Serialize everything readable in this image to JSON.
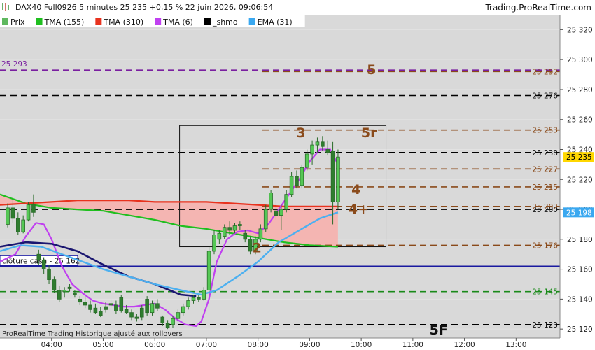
{
  "header": {
    "title": "DAX40 Full0926 5 minutes 25 235 +0,15 % 22 juin 2026, 09:06:54",
    "brand": "Trading.ProRealTime.com"
  },
  "legend": [
    {
      "label": "Prix",
      "color": "#5fb85f"
    },
    {
      "label": "TMA (155)",
      "color": "#1fbf1f"
    },
    {
      "label": "TMA (310)",
      "color": "#e8321e"
    },
    {
      "label": "TMA (6)",
      "color": "#c040f0"
    },
    {
      "label": "_shmo",
      "color": "#000000"
    },
    {
      "label": "EMA (31)",
      "color": "#3aa8f0"
    }
  ],
  "footer": {
    "note": "ProRealTime Trading  Historique ajusté aux rollovers"
  },
  "chart_data": {
    "type": "candlestick",
    "ylim": [
      25114,
      25330
    ],
    "y_ticks": [
      25120,
      25140,
      25160,
      25180,
      25200,
      25220,
      25240,
      25260,
      25280,
      25300,
      25320
    ],
    "y_tick_labels": [
      "25 120",
      "25 140",
      "25 160",
      "25 180",
      "25 200",
      "25 220",
      "25 240",
      "25 260",
      "25 280",
      "25 300",
      "25 320"
    ],
    "x_ticks": [
      "04:00",
      "05:00",
      "06:00",
      "07:00",
      "08:00",
      "09:00",
      "10:00",
      "11:00",
      "12:00",
      "13:00"
    ],
    "price_tags": [
      {
        "text": "25 235",
        "value": 25235,
        "bg": "#ffd700",
        "fg": "#000000"
      },
      {
        "text": "25 198",
        "value": 25198,
        "bg": "#3aa8f0",
        "fg": "#ffffff"
      }
    ],
    "levels": [
      {
        "value": 25293,
        "color": "#7a1fa0",
        "style": "dashed",
        "from": "start",
        "text": "25 293",
        "text_pos": "left"
      },
      {
        "value": 25292,
        "color": "#8a4a1a",
        "style": "dashed",
        "from": "mid",
        "text": "25 292",
        "text_pos": "right"
      },
      {
        "value": 25276,
        "color": "#000000",
        "style": "dashed",
        "from": "start",
        "text": "25 276",
        "text_pos": "right"
      },
      {
        "value": 25253,
        "color": "#8a4a1a",
        "style": "dashed",
        "from": "mid",
        "text": "25 253",
        "text_pos": "right"
      },
      {
        "value": 25238,
        "color": "#000000",
        "style": "dashed",
        "from": "start",
        "text": "25 238",
        "text_pos": "right"
      },
      {
        "value": 25227,
        "color": "#8a4a1a",
        "style": "dashed",
        "from": "mid",
        "text": "25 227",
        "text_pos": "right"
      },
      {
        "value": 25215,
        "color": "#8a4a1a",
        "style": "dashed",
        "from": "mid",
        "text": "25 215",
        "text_pos": "right"
      },
      {
        "value": 25202,
        "color": "#8a4a1a",
        "style": "dashed",
        "from": "mid",
        "text": "25 202",
        "text_pos": "right"
      },
      {
        "value": 25200,
        "color": "#000000",
        "style": "dashed",
        "from": "start",
        "text": "25 200",
        "text_pos": "right"
      },
      {
        "value": 25176,
        "color": "#8a4a1a",
        "style": "dashed",
        "from": "mid",
        "text": "25 176",
        "text_pos": "right"
      },
      {
        "value": 25162,
        "color": "#1a1aa0",
        "style": "solid",
        "from": "start",
        "text": "clôture cash -  25 162",
        "text_pos": "box"
      },
      {
        "value": 25145,
        "color": "#1a8a1a",
        "style": "dashed",
        "from": "start",
        "text": "25 145",
        "text_pos": "right"
      },
      {
        "value": 25123,
        "color": "#000000",
        "style": "dashed",
        "from": "start",
        "text": "25 123",
        "text_pos": "right"
      }
    ],
    "annotations": [
      {
        "text": "5",
        "time": 10.2,
        "value": 25294
      },
      {
        "text": "5r",
        "time": 10.15,
        "value": 25252
      },
      {
        "text": "4",
        "time": 9.9,
        "value": 25214
      },
      {
        "text": "4+",
        "time": 9.95,
        "value": 25201
      },
      {
        "text": "3",
        "time": 8.83,
        "value": 25252
      },
      {
        "text": "2",
        "time": 7.98,
        "value": 25175
      },
      {
        "text": "5F",
        "time": 11.5,
        "value": 25120
      }
    ],
    "box": {
      "t0": 6.48,
      "t1": 10.48,
      "v0": 25175,
      "v1": 25256
    },
    "candles": [
      [
        3.15,
        25190,
        25204,
        25188,
        25201
      ],
      [
        3.25,
        25201,
        25206,
        25191,
        25194
      ],
      [
        3.35,
        25194,
        25198,
        25183,
        25185
      ],
      [
        3.45,
        25185,
        25196,
        25184,
        25193
      ],
      [
        3.55,
        25193,
        25205,
        25192,
        25203
      ],
      [
        3.65,
        25203,
        25210,
        25195,
        25198
      ],
      [
        3.75,
        25170,
        25173,
        25163,
        25166
      ],
      [
        3.85,
        25166,
        25168,
        25157,
        25160
      ],
      [
        3.95,
        25160,
        25163,
        25150,
        25153
      ],
      [
        4.05,
        25153,
        25155,
        25144,
        25146
      ],
      [
        4.15,
        25146,
        25149,
        25138,
        25140
      ],
      [
        4.25,
        25145,
        25148,
        25141,
        25146
      ],
      [
        4.35,
        25148,
        25150,
        25145,
        25147
      ],
      [
        4.45,
        25144,
        25146,
        25141,
        25143
      ],
      [
        4.55,
        25140,
        25142,
        25136,
        25138
      ],
      [
        4.65,
        25138,
        25141,
        25134,
        25136
      ],
      [
        4.75,
        25136,
        25139,
        25131,
        25133
      ],
      [
        4.85,
        25134,
        25137,
        25130,
        25131
      ],
      [
        4.95,
        25132,
        25135,
        25128,
        25129
      ],
      [
        5.05,
        25135,
        25138,
        25131,
        25133
      ],
      [
        5.15,
        25137,
        25140,
        25134,
        25136
      ],
      [
        5.25,
        25136,
        25139,
        25130,
        25132
      ],
      [
        5.35,
        25141,
        25143,
        25131,
        25132
      ],
      [
        5.45,
        25133,
        25136,
        25130,
        25131
      ],
      [
        5.55,
        25131,
        25133,
        25126,
        25128
      ],
      [
        5.65,
        25128,
        25130,
        25125,
        25127
      ],
      [
        5.75,
        25134,
        25136,
        25126,
        25128
      ],
      [
        5.85,
        25140,
        25142,
        25129,
        25131
      ],
      [
        5.95,
        25131,
        25139,
        25129,
        25137
      ],
      [
        6.05,
        25137,
        25140,
        25132,
        25134
      ],
      [
        6.15,
        25128,
        25129,
        25122,
        25124
      ],
      [
        6.25,
        25124,
        25126,
        25120,
        25121
      ],
      [
        6.35,
        25123,
        25129,
        25121,
        25127
      ],
      [
        6.45,
        25127,
        25133,
        25125,
        25131
      ],
      [
        6.55,
        25131,
        25137,
        25129,
        25135
      ],
      [
        6.65,
        25135,
        25141,
        25133,
        25139
      ],
      [
        6.75,
        25139,
        25143,
        25137,
        25141
      ],
      [
        6.85,
        25141,
        25143,
        25138,
        25140
      ],
      [
        6.95,
        25140,
        25148,
        25139,
        25146
      ],
      [
        7.05,
        25146,
        25175,
        25144,
        25172
      ],
      [
        7.15,
        25172,
        25186,
        25170,
        25183
      ],
      [
        7.25,
        25180,
        25186,
        25177,
        25184
      ],
      [
        7.35,
        25182,
        25190,
        25180,
        25188
      ],
      [
        7.45,
        25188,
        25192,
        25183,
        25186
      ],
      [
        7.55,
        25186,
        25191,
        25184,
        25189
      ],
      [
        7.65,
        25189,
        25192,
        25186,
        25190
      ],
      [
        7.75,
        25184,
        25186,
        25178,
        25180
      ],
      [
        7.85,
        25180,
        25182,
        25170,
        25172
      ],
      [
        7.95,
        25172,
        25182,
        25170,
        25180
      ],
      [
        8.05,
        25180,
        25190,
        25178,
        25187
      ],
      [
        8.15,
        25187,
        25203,
        25185,
        25200
      ],
      [
        8.25,
        25200,
        25213,
        25198,
        25211
      ],
      [
        8.35,
        25199,
        25206,
        25193,
        25196
      ],
      [
        8.45,
        25196,
        25203,
        25186,
        25200
      ],
      [
        8.55,
        25200,
        25213,
        25198,
        25210
      ],
      [
        8.65,
        25210,
        25225,
        25208,
        25222
      ],
      [
        8.75,
        25222,
        25226,
        25214,
        25216
      ],
      [
        8.85,
        25216,
        25230,
        25214,
        25228
      ],
      [
        8.95,
        25228,
        25240,
        25226,
        25237
      ],
      [
        9.05,
        25237,
        25246,
        25230,
        25243
      ],
      [
        9.15,
        25243,
        25248,
        25238,
        25245
      ],
      [
        9.25,
        25245,
        25249,
        25239,
        25242
      ],
      [
        9.35,
        25240,
        25246,
        25236,
        25238
      ],
      [
        9.45,
        25239,
        25245,
        25190,
        25205
      ],
      [
        9.55,
        25205,
        25240,
        25200,
        25235
      ]
    ],
    "series": [
      {
        "name": "TMA (155)",
        "color": "#1fbf1f",
        "width": 2.2,
        "points": [
          [
            3.0,
            25210
          ],
          [
            3.5,
            25204
          ],
          [
            4.0,
            25201
          ],
          [
            4.5,
            25200
          ],
          [
            5.0,
            25199
          ],
          [
            5.5,
            25196
          ],
          [
            6.0,
            25193
          ],
          [
            6.5,
            25189
          ],
          [
            7.0,
            25187
          ],
          [
            7.5,
            25184
          ],
          [
            8.0,
            25181
          ],
          [
            8.5,
            25178
          ],
          [
            9.0,
            25176
          ],
          [
            9.55,
            25175
          ]
        ]
      },
      {
        "name": "TMA (310)",
        "color": "#e8321e",
        "width": 2.2,
        "points": [
          [
            3.0,
            25203
          ],
          [
            3.5,
            25204
          ],
          [
            4.0,
            25205
          ],
          [
            4.5,
            25206
          ],
          [
            5.0,
            25206
          ],
          [
            5.5,
            25206
          ],
          [
            6.0,
            25205
          ],
          [
            6.5,
            25205
          ],
          [
            7.0,
            25205
          ],
          [
            7.5,
            25204
          ],
          [
            8.0,
            25203
          ],
          [
            8.5,
            25202
          ],
          [
            9.0,
            25202
          ],
          [
            9.55,
            25202
          ]
        ]
      },
      {
        "name": "TMA (6)",
        "color": "#c040f0",
        "width": 2.2,
        "points": [
          [
            3.0,
            25165
          ],
          [
            3.3,
            25170
          ],
          [
            3.5,
            25182
          ],
          [
            3.7,
            25191
          ],
          [
            3.85,
            25190
          ],
          [
            4.0,
            25180
          ],
          [
            4.2,
            25162
          ],
          [
            4.4,
            25150
          ],
          [
            4.6,
            25144
          ],
          [
            4.8,
            25139
          ],
          [
            5.0,
            25137
          ],
          [
            5.2,
            25136
          ],
          [
            5.4,
            25135
          ],
          [
            5.6,
            25135
          ],
          [
            5.8,
            25136
          ],
          [
            6.0,
            25137
          ],
          [
            6.2,
            25133
          ],
          [
            6.4,
            25127
          ],
          [
            6.6,
            25123
          ],
          [
            6.8,
            25122
          ],
          [
            6.9,
            25125
          ],
          [
            7.05,
            25140
          ],
          [
            7.2,
            25165
          ],
          [
            7.4,
            25180
          ],
          [
            7.6,
            25185
          ],
          [
            7.8,
            25186
          ],
          [
            8.0,
            25184
          ],
          [
            8.2,
            25190
          ],
          [
            8.4,
            25200
          ],
          [
            8.6,
            25210
          ],
          [
            8.8,
            25220
          ],
          [
            9.0,
            25232
          ],
          [
            9.2,
            25240
          ],
          [
            9.4,
            25240
          ],
          [
            9.55,
            25230
          ]
        ]
      },
      {
        "name": "_shmo",
        "color": "#1a1670",
        "width": 2.6,
        "points": [
          [
            3.0,
            25175
          ],
          [
            3.5,
            25178
          ],
          [
            4.0,
            25177
          ],
          [
            4.5,
            25172
          ],
          [
            5.0,
            25163
          ],
          [
            5.5,
            25155
          ],
          [
            6.0,
            25150
          ],
          [
            6.5,
            25143
          ],
          [
            6.8,
            25142
          ]
        ]
      },
      {
        "name": "EMA (31)",
        "color": "#4cb0f0",
        "width": 2.4,
        "points": [
          [
            3.0,
            25172
          ],
          [
            3.4,
            25176
          ],
          [
            3.8,
            25175
          ],
          [
            4.2,
            25170
          ],
          [
            4.6,
            25165
          ],
          [
            5.0,
            25160
          ],
          [
            5.5,
            25155
          ],
          [
            6.0,
            25150
          ],
          [
            6.5,
            25146
          ],
          [
            6.9,
            25143
          ],
          [
            7.2,
            25146
          ],
          [
            7.6,
            25155
          ],
          [
            8.0,
            25165
          ],
          [
            8.4,
            25178
          ],
          [
            8.8,
            25186
          ],
          [
            9.2,
            25194
          ],
          [
            9.55,
            25198
          ]
        ]
      }
    ]
  }
}
